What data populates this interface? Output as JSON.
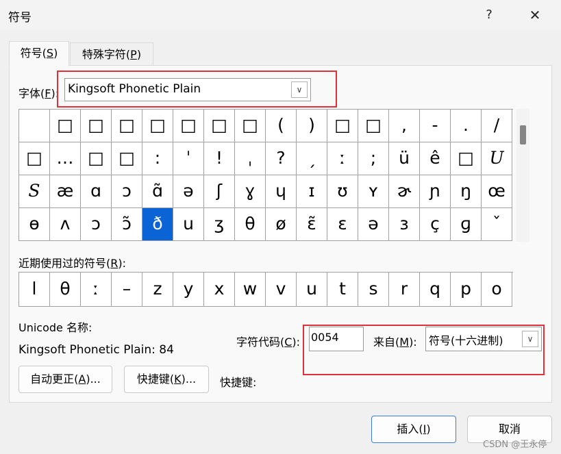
{
  "window": {
    "title": "符号",
    "help": "?",
    "close": "✕"
  },
  "tabs": [
    {
      "label": "符号(",
      "key": "S",
      "suffix": ")"
    },
    {
      "label": "特殊字符(",
      "key": "P",
      "suffix": ")"
    }
  ],
  "font": {
    "label": "字体(",
    "key": "F",
    "suffix": "):",
    "value": "Kingsoft Phonetic Plain",
    "dropdown": "∨"
  },
  "symbols": [
    [
      "",
      "□",
      "□",
      "□",
      "□",
      "□",
      "□",
      "□",
      "(",
      ")",
      "□",
      "□",
      ",",
      "-",
      ".",
      "/"
    ],
    [
      "□",
      "…",
      "□",
      "□",
      ":",
      "ˈ",
      "!",
      "ˌ",
      "?",
      "ˏ",
      "ː",
      ";",
      "ü",
      "ê",
      "□",
      "U"
    ],
    [
      "S",
      "æ",
      "ɑ",
      "ɔ",
      "ɑ̃",
      "ə",
      "ʃ",
      "ɣ",
      "ɥ",
      "ɪ",
      "ʊ",
      "ʏ",
      "ɚ",
      "ɲ",
      "ŋ",
      "œ"
    ],
    [
      "ɵ",
      "ʌ",
      "ɔ",
      "ɔ̃",
      "ð",
      "u",
      "ʒ",
      "θ",
      "ø",
      "ɛ̃",
      "ɛ",
      "ə",
      "ɜ",
      "ç",
      "ɡ",
      "ˇ"
    ]
  ],
  "selected": {
    "row": 3,
    "col": 4
  },
  "recent": {
    "label": "近期使用过的符号(",
    "key": "R",
    "suffix": "):",
    "items": [
      "l",
      "θ",
      "ː",
      "–",
      "z",
      "y",
      "x",
      "w",
      "v",
      "u",
      "t",
      "s",
      "r",
      "q",
      "p",
      "o"
    ]
  },
  "unicode": {
    "label": "Unicode 名称:",
    "name": "Kingsoft Phonetic Plain: 84"
  },
  "char_code": {
    "label": "字符代码(",
    "key": "C",
    "suffix": "):",
    "value": "0054"
  },
  "from": {
    "label": "来自(",
    "key": "M",
    "suffix": "):",
    "value": "符号(十六进制)",
    "dropdown": "∨"
  },
  "autocorrect": {
    "label": "自动更正(",
    "key": "A",
    "suffix": ")..."
  },
  "shortcut_btn": {
    "label": "快捷键(",
    "key": "K",
    "suffix": ")..."
  },
  "shortcut_label": "快捷键:",
  "insert": {
    "label": "插入(",
    "key": "I",
    "suffix": ")"
  },
  "cancel": "取消",
  "watermark": "CSDN @王永停",
  "colors": {
    "accent": "#0a64d6",
    "highlight": "#e0303a"
  }
}
